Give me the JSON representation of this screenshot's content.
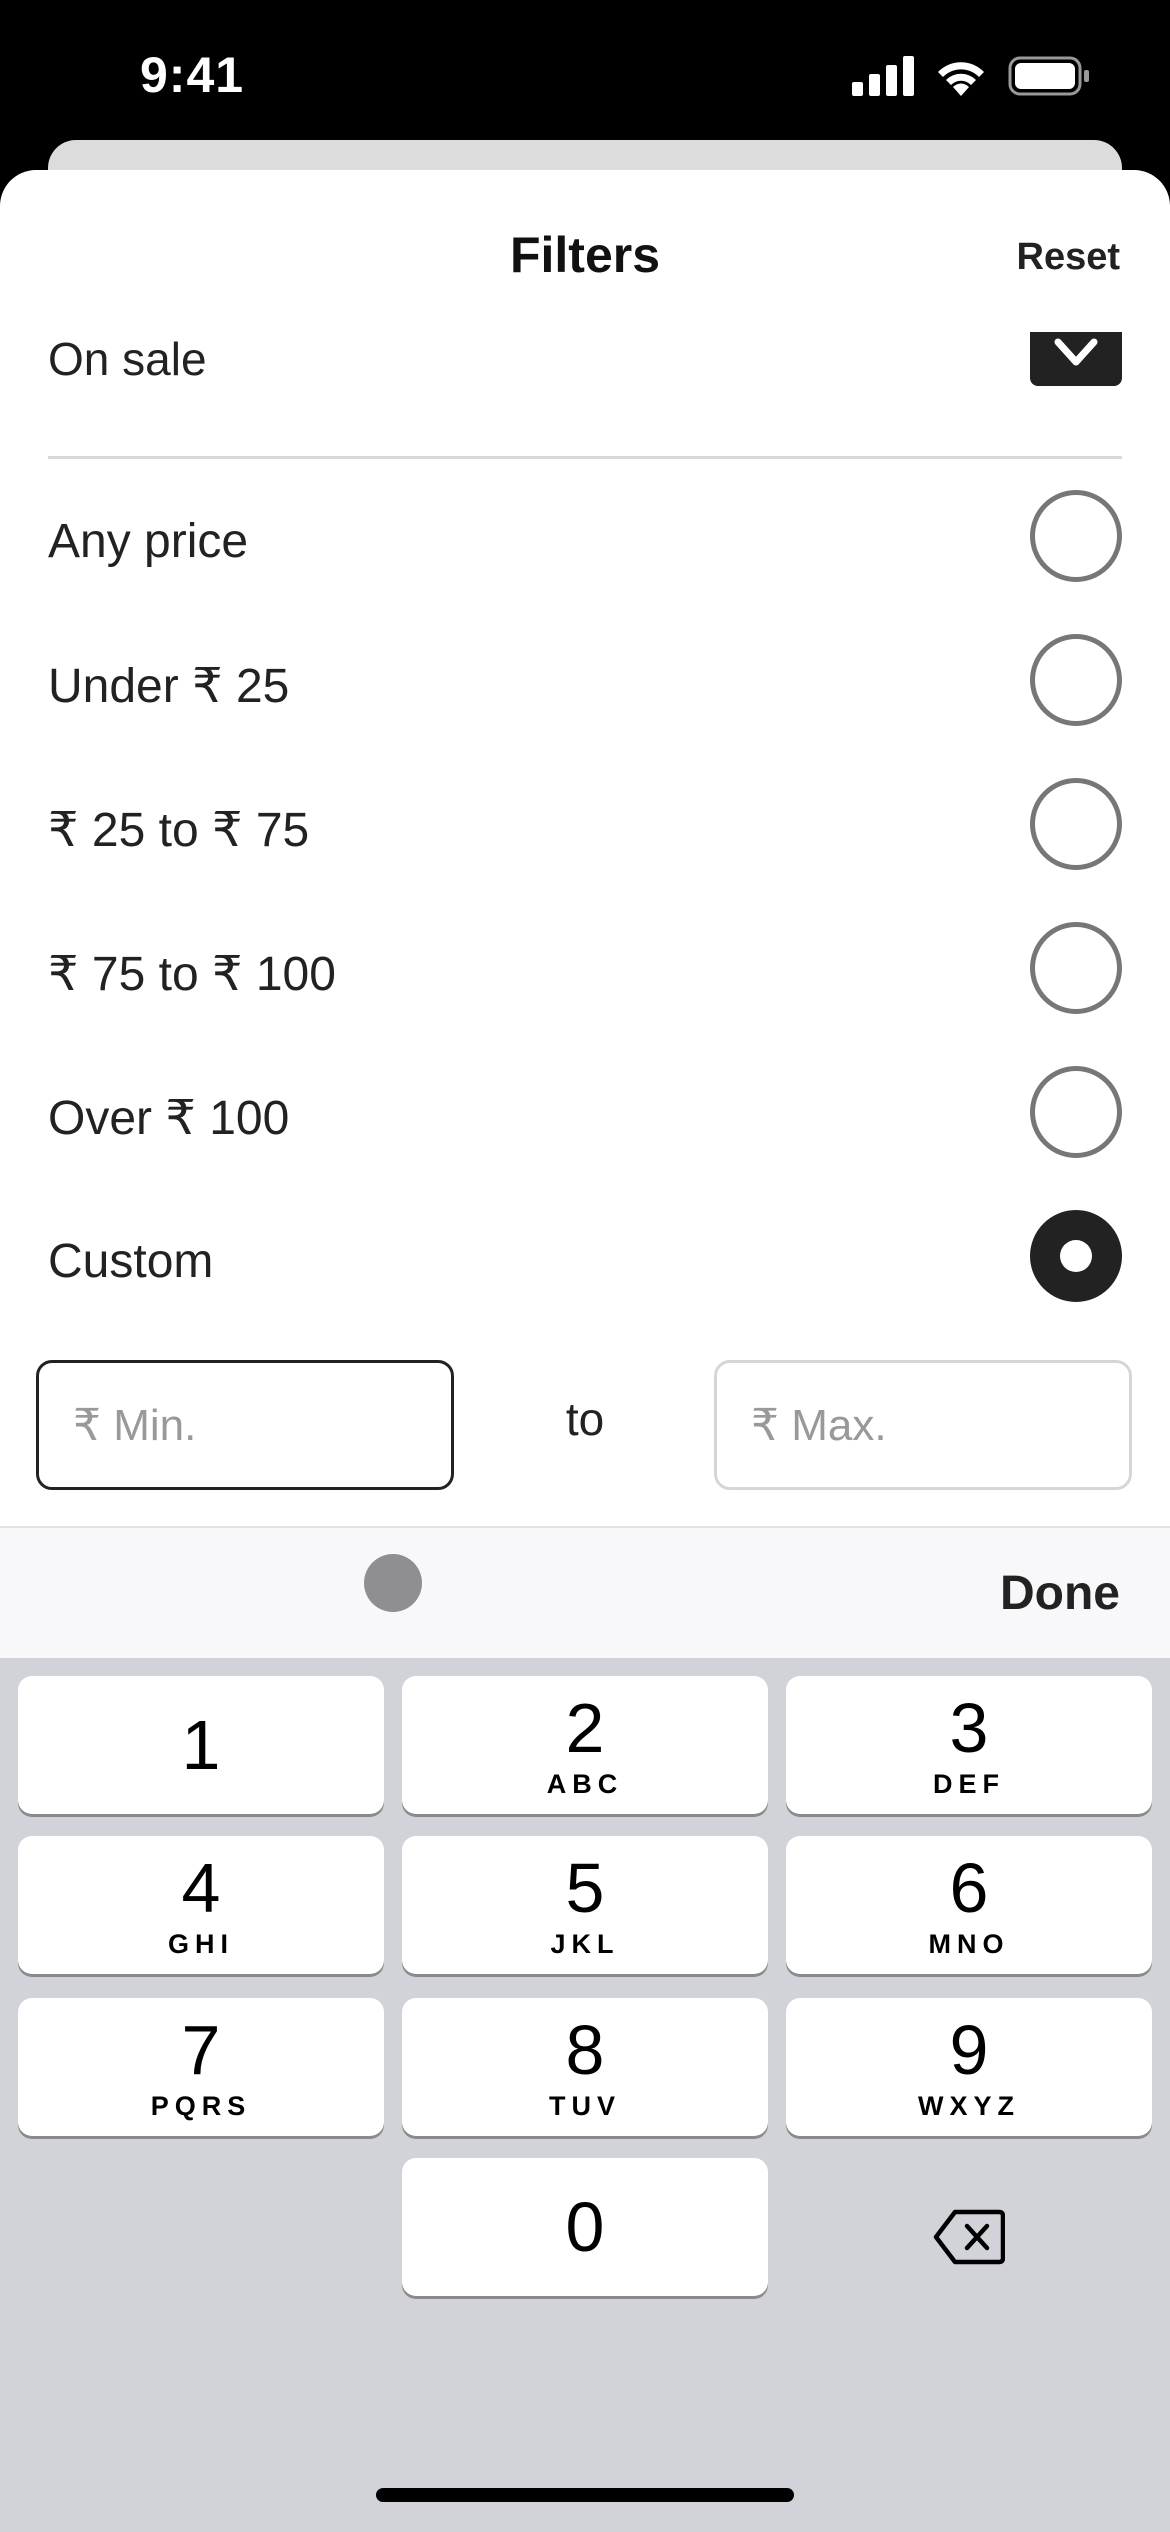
{
  "status_bar": {
    "time": "9:41"
  },
  "header": {
    "title": "Filters",
    "reset_label": "Reset"
  },
  "on_sale": {
    "label": "On sale",
    "checked": true
  },
  "price_options": [
    {
      "label": "Any price",
      "selected": false
    },
    {
      "label": "Under ₹ 25",
      "selected": false
    },
    {
      "label": "₹ 25 to ₹ 75",
      "selected": false
    },
    {
      "label": "₹ 75 to ₹ 100",
      "selected": false
    },
    {
      "label": "Over ₹ 100",
      "selected": false
    },
    {
      "label": "Custom",
      "selected": true
    }
  ],
  "custom_range": {
    "min_placeholder": "₹ Min.",
    "to_label": "to",
    "max_placeholder": "₹ Max."
  },
  "keyboard_toolbar": {
    "done_label": "Done"
  },
  "keypad": {
    "keys": [
      {
        "digit": "1",
        "letters": ""
      },
      {
        "digit": "2",
        "letters": "ABC"
      },
      {
        "digit": "3",
        "letters": "DEF"
      },
      {
        "digit": "4",
        "letters": "GHI"
      },
      {
        "digit": "5",
        "letters": "JKL"
      },
      {
        "digit": "6",
        "letters": "MNO"
      },
      {
        "digit": "7",
        "letters": "PQRS"
      },
      {
        "digit": "8",
        "letters": "TUV"
      },
      {
        "digit": "9",
        "letters": "WXYZ"
      },
      {
        "digit": "0",
        "letters": ""
      }
    ]
  },
  "icons": {
    "signal": "cellular-signal-icon",
    "wifi": "wifi-icon",
    "battery": "battery-icon",
    "backspace": "backspace-icon",
    "check": "checkmark-icon"
  }
}
